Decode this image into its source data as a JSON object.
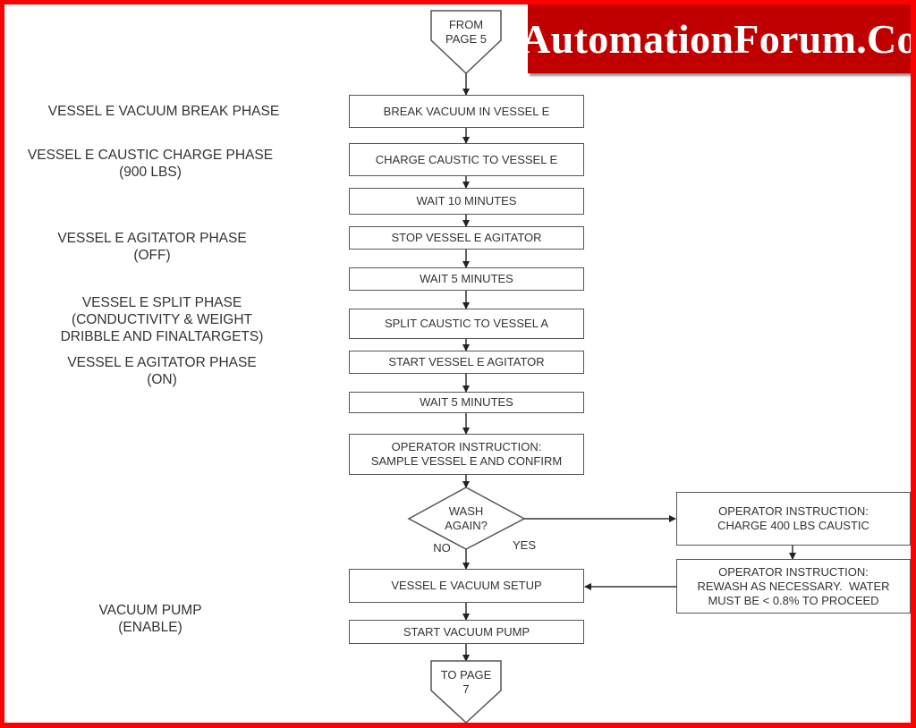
{
  "brand": {
    "text": "AutomationForum.Co",
    "bg_color": "#c00000",
    "frame_color": "#ff0000"
  },
  "connectors": {
    "from": {
      "line1": "FROM",
      "line2": "PAGE 5"
    },
    "to": {
      "line1": "TO PAGE",
      "line2": "7"
    }
  },
  "phase_labels": [
    {
      "lines": [
        "VESSEL E VACUUM BREAK PHASE"
      ]
    },
    {
      "lines": [
        "VESSEL E CAUSTIC CHARGE PHASE",
        "(900 LBS)"
      ]
    },
    {
      "lines": [
        "VESSEL E AGITATOR PHASE",
        "(OFF)"
      ]
    },
    {
      "lines": [
        "VESSEL E SPLIT PHASE",
        "(CONDUCTIVITY & WEIGHT",
        "DRIBBLE AND FINALTARGETS)"
      ]
    },
    {
      "lines": [
        "VESSEL E AGITATOR PHASE",
        "(ON)"
      ]
    },
    {
      "lines": [
        "VACUUM PUMP",
        "(ENABLE)"
      ]
    }
  ],
  "steps": [
    {
      "text": "BREAK VACUUM IN VESSEL E"
    },
    {
      "text": "CHARGE CAUSTIC TO VESSEL E"
    },
    {
      "text": "WAIT 10 MINUTES"
    },
    {
      "text": "STOP VESSEL E AGITATOR"
    },
    {
      "text": "WAIT 5 MINUTES"
    },
    {
      "text": "SPLIT CAUSTIC TO VESSEL A"
    },
    {
      "text": "START VESSEL E AGITATOR"
    },
    {
      "text": "WAIT 5 MINUTES"
    },
    {
      "line1": "OPERATOR INSTRUCTION:",
      "line2": "SAMPLE VESSEL E AND CONFIRM"
    },
    {
      "text": "VESSEL E VACUUM SETUP"
    },
    {
      "text": "START VACUUM PUMP"
    }
  ],
  "decision": {
    "line1": "WASH",
    "line2": "AGAIN?",
    "no_label": "NO",
    "yes_label": "YES"
  },
  "side_steps": [
    {
      "line1": "OPERATOR INSTRUCTION:",
      "line2": "CHARGE 400 LBS CAUSTIC"
    },
    {
      "line1": "OPERATOR INSTRUCTION:",
      "line2": "REWASH AS NECESSARY.  WATER",
      "line3": "MUST BE < 0.8% TO PROCEED"
    }
  ]
}
